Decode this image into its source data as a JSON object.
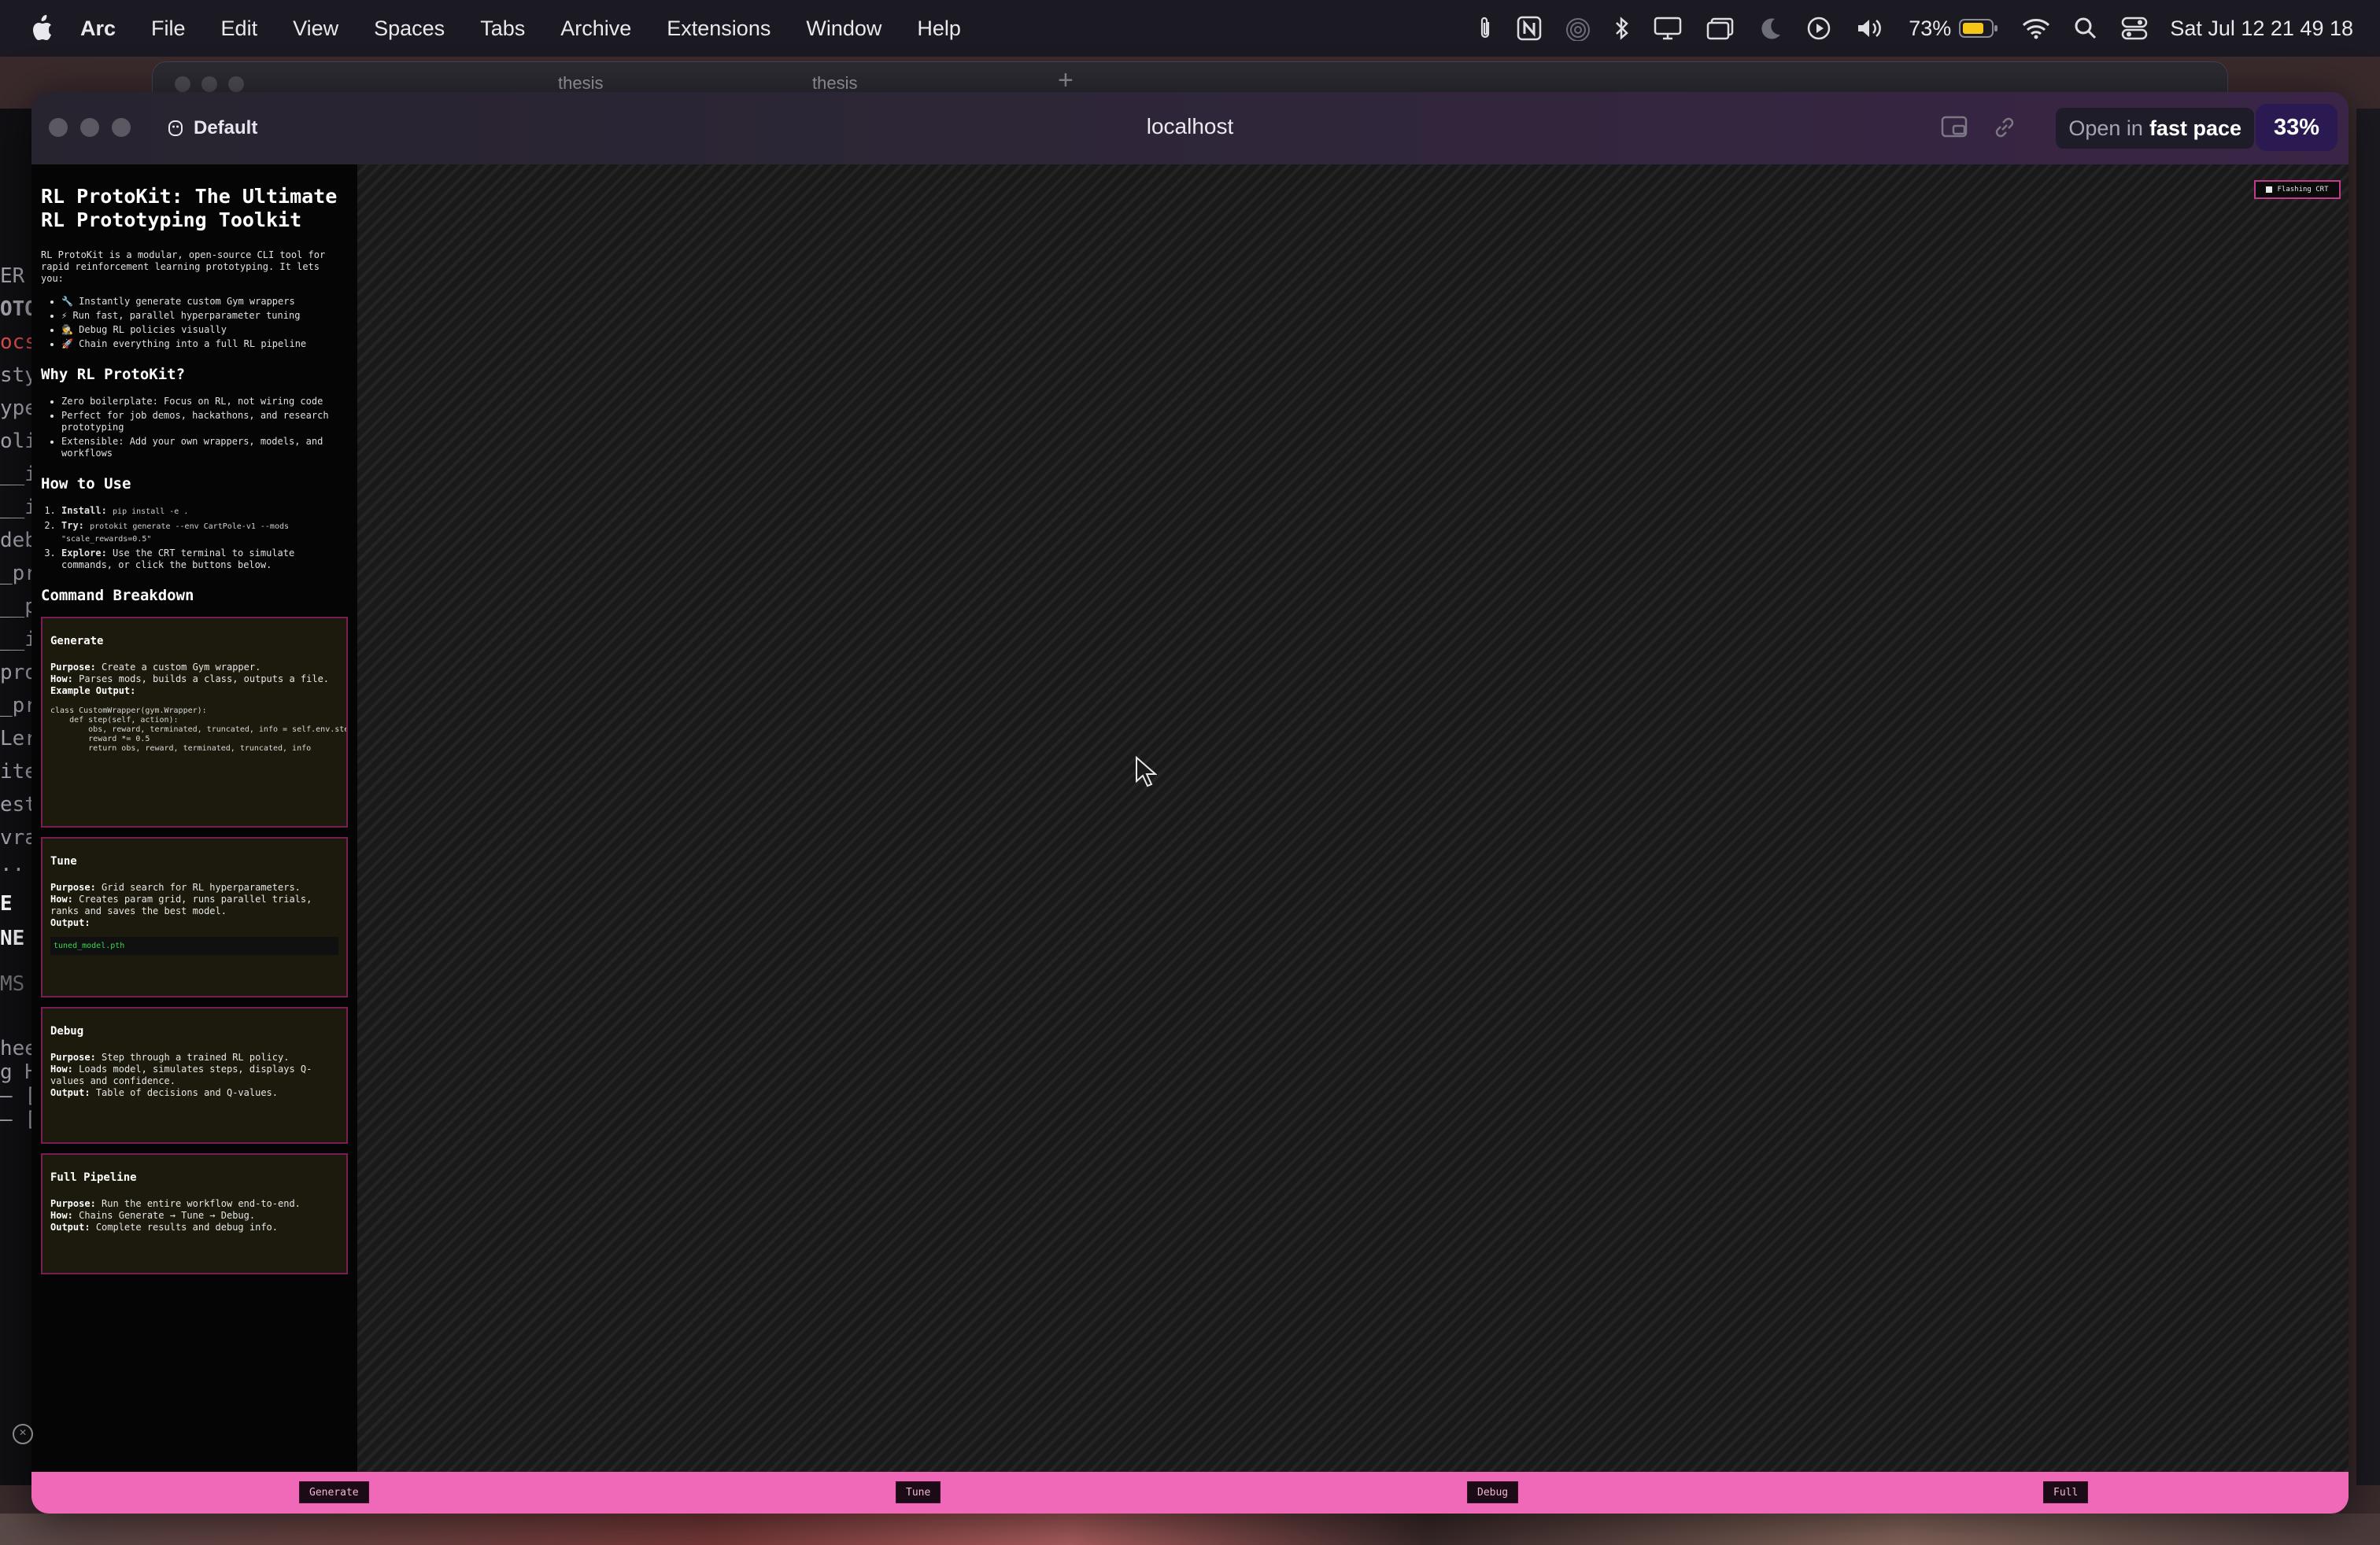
{
  "menubar": {
    "app": "Arc",
    "items": [
      "File",
      "Edit",
      "View",
      "Spaces",
      "Tabs",
      "Archive",
      "Extensions",
      "Window",
      "Help"
    ],
    "battery": "73%",
    "clock": "Sat Jul 12  21 49 18"
  },
  "background_window": {
    "tabs": [
      "thesis",
      "thesis"
    ]
  },
  "left_terminal": {
    "lines": [
      "ER",
      "OTO",
      "ocs",
      "sty",
      "ype",
      "olic",
      "__i",
      "__i",
      "deb",
      "_pr",
      "__p",
      "__i",
      "pro",
      "_pr",
      "Ler",
      "ite",
      "ests",
      "vrap",
      "..",
      "E",
      "NE",
      "MS",
      "hee",
      "g H",
      "— [",
      "— ["
    ]
  },
  "window": {
    "profile": "Default",
    "url": "localhost",
    "open_in_prefix": "Open in",
    "open_in_target": "fast pace",
    "zoom": "33%"
  },
  "page": {
    "title": "RL ProtoKit: The Ultimate RL Prototyping Toolkit",
    "intro": "RL ProtoKit is a modular, open-source CLI tool for rapid reinforcement learning prototyping. It lets you:",
    "features": [
      "🔧 Instantly generate custom Gym wrappers",
      "⚡ Run fast, parallel hyperparameter tuning",
      "🕵 Debug RL policies visually",
      "🚀 Chain everything into a full RL pipeline"
    ],
    "why_heading": "Why RL ProtoKit?",
    "why_items": [
      "Zero boilerplate: Focus on RL, not wiring code",
      "Perfect for job demos, hackathons, and research prototyping",
      "Extensible: Add your own wrappers, models, and workflows"
    ],
    "how_heading": "How to Use",
    "how_steps": [
      {
        "label": "Install:",
        "text": "",
        "cmd": "pip install -e ."
      },
      {
        "label": "Try:",
        "text": "",
        "cmd": "protokit generate --env CartPole-v1 --mods \"scale_rewards=0.5\""
      },
      {
        "label": "Explore:",
        "text": "Use the CRT terminal to simulate commands, or click the buttons below.",
        "cmd": ""
      }
    ],
    "breakdown_heading": "Command Breakdown",
    "labels": {
      "purpose": "Purpose:",
      "how": "How:",
      "output": "Output:",
      "example_output": "Example Output:"
    },
    "cards": {
      "generate": {
        "title": "Generate",
        "purpose": "Create a custom Gym wrapper.",
        "how": "Parses mods, builds a class, outputs a file.",
        "code": "class CustomWrapper(gym.Wrapper):\n    def step(self, action):\n        obs, reward, terminated, truncated, info = self.env.ste\n        reward *= 0.5\n        return obs, reward, terminated, truncated, info"
      },
      "tune": {
        "title": "Tune",
        "purpose": "Grid search for RL hyperparameters.",
        "how": "Creates param grid, runs parallel trials, ranks and saves the best model.",
        "output_file": "tuned_model.pth"
      },
      "debug": {
        "title": "Debug",
        "purpose": "Step through a trained RL policy.",
        "how": "Loads model, simulates steps, displays Q-values and confidence.",
        "output": "Table of decisions and Q-values."
      },
      "full": {
        "title": "Full Pipeline",
        "purpose": "Run the entire workflow end-to-end.",
        "how": "Chains Generate → Tune → Debug.",
        "output": "Complete results and debug info."
      }
    },
    "flash_toggle": "Flashing CRT",
    "bottom_buttons": [
      "Generate",
      "Tune",
      "Debug",
      "Full"
    ]
  }
}
